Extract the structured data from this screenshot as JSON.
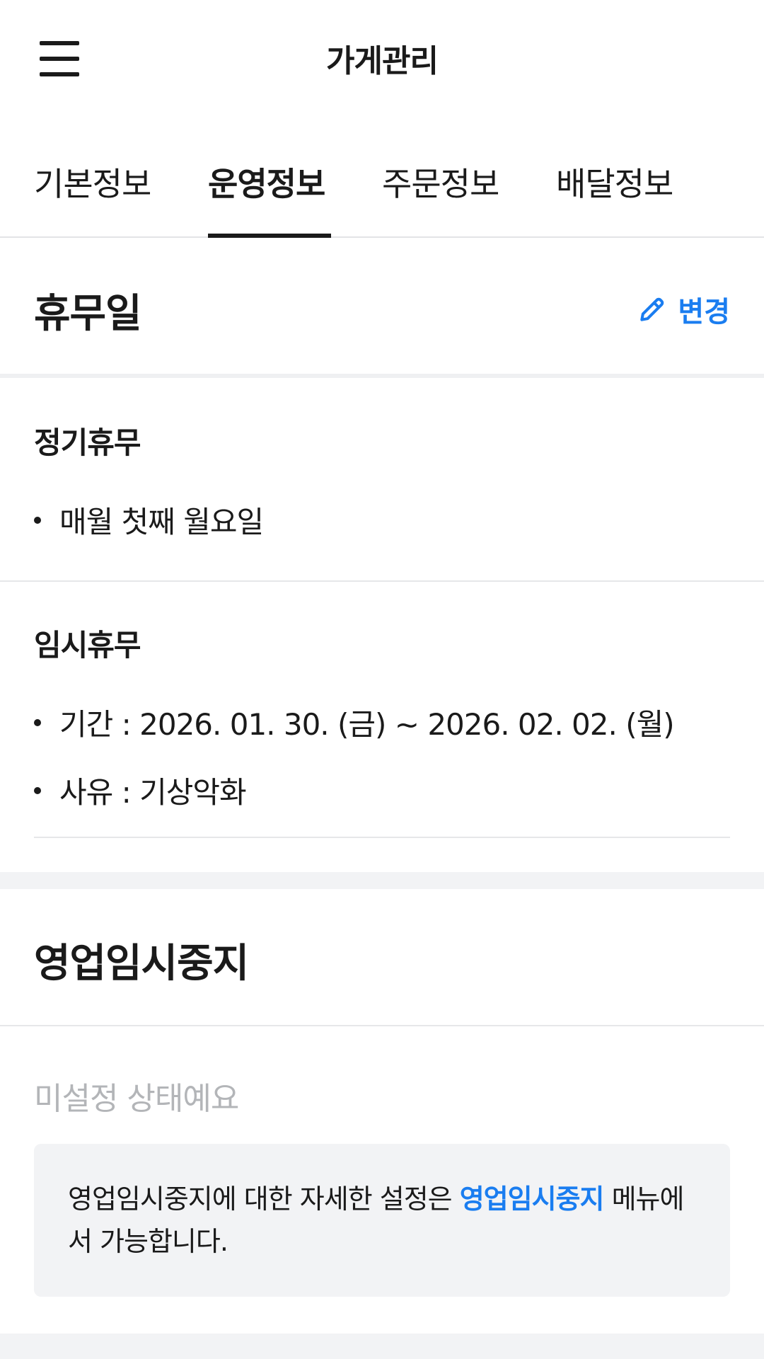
{
  "header": {
    "title": "가게관리",
    "menu_icon": "hamburger-menu-icon"
  },
  "tabs": [
    {
      "label": "기본정보",
      "active": false
    },
    {
      "label": "운영정보",
      "active": true
    },
    {
      "label": "주문정보",
      "active": false
    },
    {
      "label": "배달정보",
      "active": false
    }
  ],
  "holiday": {
    "title": "휴무일",
    "edit_label": "변경",
    "edit_icon": "pencil-icon",
    "regular": {
      "title": "정기휴무",
      "items": [
        "매월 첫째 월요일"
      ]
    },
    "temporary": {
      "title": "임시휴무",
      "period": "기간 : 2026. 01. 30. (금) ~ 2026. 02. 02. (월)",
      "reason": "사유 : 기상악화"
    }
  },
  "pause": {
    "title": "영업임시중지",
    "status": "미설정 상태예요",
    "info_prefix": "영업임시중지에 대한 자세한 설정은 ",
    "info_link": "영업임시중지",
    "info_suffix": " 메뉴에서 가능합니다."
  },
  "colors": {
    "accent": "#1a7df0",
    "text": "#1a1a1a",
    "muted": "#b3b5b8",
    "background": "#f2f3f5"
  }
}
